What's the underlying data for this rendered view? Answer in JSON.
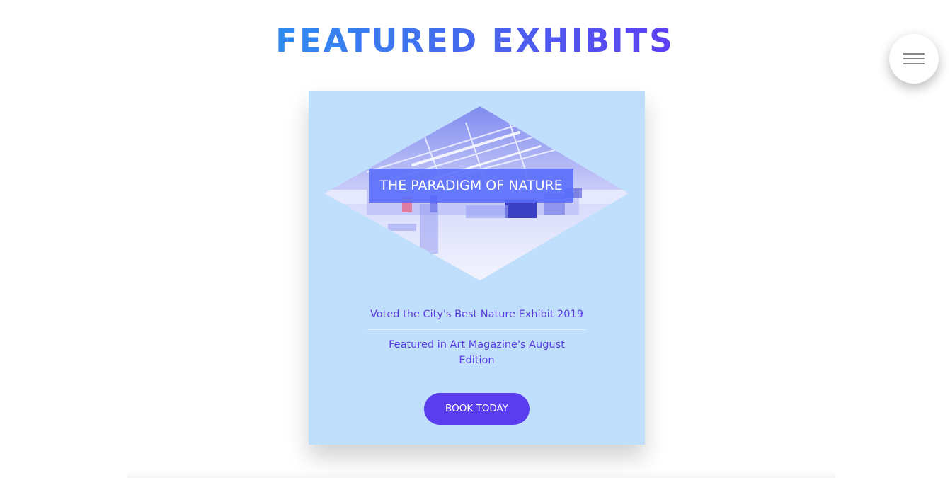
{
  "section": {
    "title": "FEATURED EXHIBITS"
  },
  "menu": {
    "icon": "hamburger-menu-icon"
  },
  "exhibit": {
    "name": "THE PARADIGM OF NATURE",
    "image": "gallery-interior-photo",
    "awards": [
      "Voted the City's Best Nature Exhibit 2019",
      "Featured in Art Magazine's August Edition"
    ],
    "cta_label": "BOOK TODAY"
  },
  "colors": {
    "title_gradient_start": "#2e8cf0",
    "title_gradient_end": "#5b3ef2",
    "card_background": "#c0dffc",
    "accent": "#5b3df0",
    "award_text": "#5a3be0"
  }
}
